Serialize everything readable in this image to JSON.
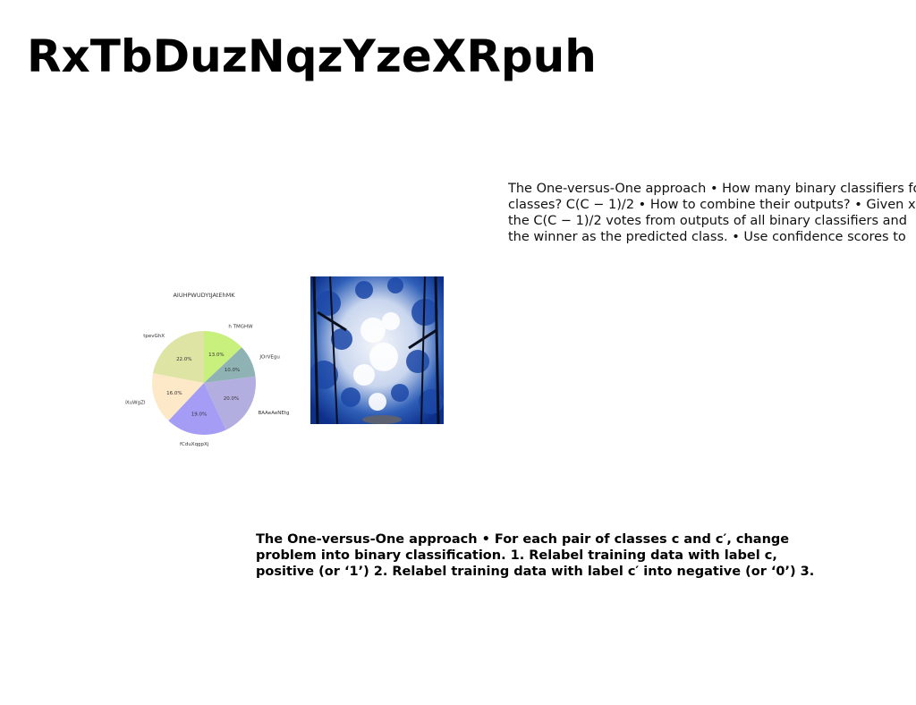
{
  "slide": {
    "title": "RxTbDuzNqzYzeXRpuh",
    "right_text_lines": [
      "The One-versus-One approach • How many binary classifiers for",
      "classes? C(C − 1)/2 • How to combine their outputs? • Given x,",
      "the C(C − 1)/2 votes from outputs of all binary classifiers and",
      "the winner as the predicted class. • Use confidence scores to"
    ],
    "bottom_text_lines": [
      "The One-versus-One approach • For each pair of classes c and c′, change",
      "problem into binary classification. 1. Relabel training data with label c,",
      "positive (or ‘1’) 2. Relabel training data with label c′ into negative (or ‘0’) 3."
    ]
  },
  "chart_data": {
    "type": "pie",
    "title": "AIUHPWUDYtJAtEhMK",
    "categories": [
      "h TMGHW",
      "JOrVEgu",
      "BAAeAeNEtg",
      "fCduXqgpXj",
      "MXuWgZl",
      "tpevGhX"
    ],
    "values": [
      13.0,
      10.0,
      20.0,
      19.0,
      16.0,
      22.0
    ],
    "labels": [
      "13.0%",
      "10.0%",
      "20.0%",
      "19.0%",
      "16.0%",
      "22.0%"
    ],
    "colors": [
      "#c8f07c",
      "#8fb3b5",
      "#b3aee0",
      "#a49cf5",
      "#fde9c8",
      "#dde4a4"
    ],
    "start_angle": "top, clockwise"
  }
}
